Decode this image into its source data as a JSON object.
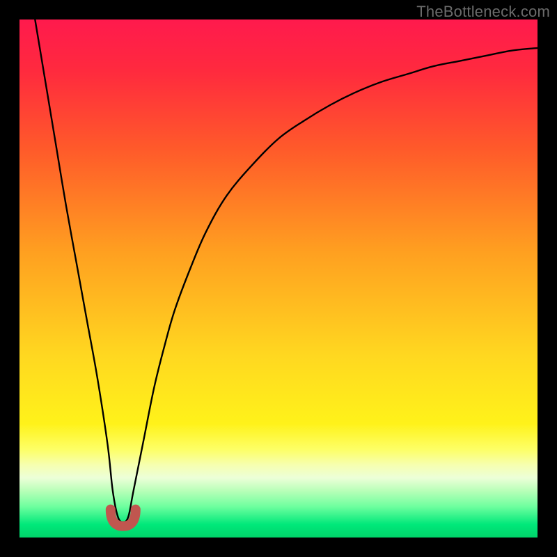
{
  "attribution": "TheBottleneck.com",
  "colors": {
    "frame": "#000000",
    "gradient_stops": [
      {
        "offset": 0.0,
        "color": "#ff1a4d"
      },
      {
        "offset": 0.1,
        "color": "#ff2a3e"
      },
      {
        "offset": 0.25,
        "color": "#ff5a2a"
      },
      {
        "offset": 0.45,
        "color": "#ffa020"
      },
      {
        "offset": 0.65,
        "color": "#ffd820"
      },
      {
        "offset": 0.78,
        "color": "#fff21a"
      },
      {
        "offset": 0.83,
        "color": "#fdff66"
      },
      {
        "offset": 0.86,
        "color": "#f6ffb0"
      },
      {
        "offset": 0.885,
        "color": "#ecffd8"
      },
      {
        "offset": 0.91,
        "color": "#b8ffb8"
      },
      {
        "offset": 0.94,
        "color": "#6fff9f"
      },
      {
        "offset": 0.975,
        "color": "#00e87a"
      },
      {
        "offset": 1.0,
        "color": "#00d46a"
      }
    ],
    "curve_stroke": "#000000",
    "marker_fill": "#c0564f"
  },
  "chart_data": {
    "type": "line",
    "title": "",
    "xlabel": "",
    "ylabel": "",
    "xlim": [
      0,
      100
    ],
    "ylim": [
      0,
      100
    ],
    "series": [
      {
        "name": "bottleneck-curve",
        "x": [
          3,
          5,
          7,
          9,
          11,
          13,
          15,
          17,
          18,
          19,
          20,
          21,
          22,
          24,
          26,
          28,
          30,
          33,
          36,
          40,
          45,
          50,
          55,
          60,
          65,
          70,
          75,
          80,
          85,
          90,
          95,
          100
        ],
        "y": [
          100,
          88,
          76,
          64,
          53,
          42,
          31,
          18,
          9,
          4,
          3,
          4,
          9,
          19,
          29,
          37,
          44,
          52,
          59,
          66,
          72,
          77,
          80.5,
          83.5,
          86,
          88,
          89.5,
          91,
          92,
          93,
          94,
          94.5
        ]
      }
    ],
    "annotations": [
      {
        "name": "optimal-point",
        "x": 20,
        "y": 3
      }
    ],
    "legend": false,
    "grid": false
  }
}
